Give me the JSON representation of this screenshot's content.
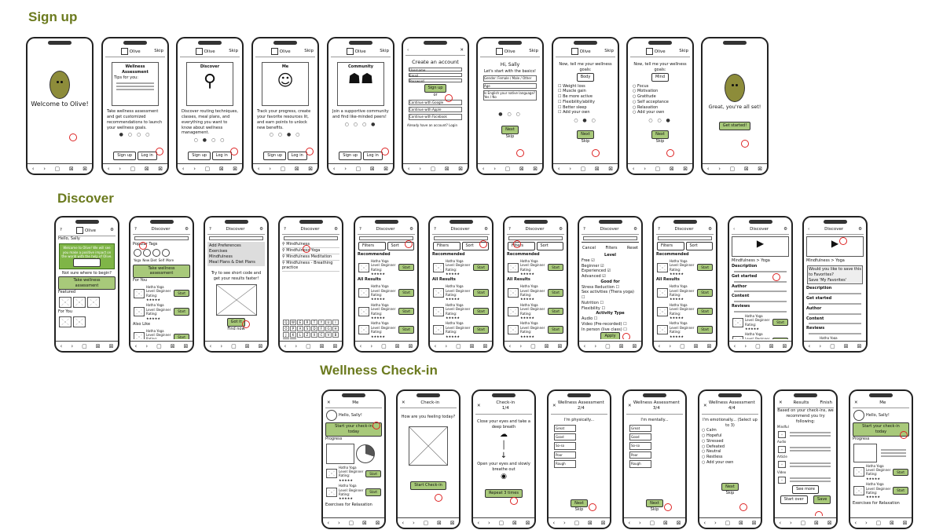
{
  "sections": {
    "signup": "Sign up",
    "discover": "Discover",
    "wellness": "Wellness Check-in"
  },
  "common": {
    "app_name": "Olive",
    "skip": "Skip",
    "sign_up": "Sign up",
    "log_in": "Log in",
    "next": "Next",
    "discover": "Discover",
    "me": "Me",
    "check_in": "Check-in",
    "filters": "Filters",
    "sort": "Sort",
    "recommended": "Recommended",
    "all_results": "All Results",
    "browse_more": "Browse more",
    "not_sure": "Not sure where to begin?",
    "take_assessment": "Take wellness assessment",
    "start": "Start",
    "yoga_title": "Hatha Yoga",
    "level_beginner": "Level: Beginner",
    "level_advanced": "Level: Advanced",
    "rating": "Rating: ★★★★★",
    "nav": [
      "Home",
      "Discover",
      "Me",
      "Community",
      "More"
    ],
    "nav_glyphs": [
      "‹",
      "›",
      "▢",
      "⊠",
      "⊠"
    ]
  },
  "signup": {
    "welcome": "Welcome to Olive!",
    "s2_title": "Wellness Assessment",
    "s2_sub": "Tips for you:",
    "s2_body": "Take wellness assessment and get customized recommendations to launch your wellness goals.",
    "s3_title": "Discover",
    "s3_body": "Discover routing techniques, classes, meal plans, and everything you want to know about wellness management.",
    "s4_title": "Me",
    "s4_body": "Track your progress, create your favorite resources lit, and earn points to unlock new benefits.",
    "s5_title": "Community",
    "s5_body": "Join a supportive community and find like-minded peers!",
    "create_title": "Create an account",
    "ph_username": "Username",
    "ph_email": "Email",
    "ph_password": "Password",
    "or": "or",
    "google": "Continue with Google",
    "apple": "Continue with Apple",
    "facebook": "Continue with Facebook",
    "have_account": "Already have an account?",
    "login_link": "Login",
    "hi": "Hi, Sally",
    "basics": "Let's start with the basics!",
    "gender": "Gender: Female / Male / Other",
    "age": "Age",
    "english": "Is English your native language?",
    "yes_no": "Yes / No",
    "goals": "Now, tell me your wellness goals:",
    "body": "Body",
    "goals_body": [
      "Weight loss",
      "Muscle gain",
      "Be more active",
      "Flexibility/ability",
      "Better sleep",
      "Add your own"
    ],
    "mind": "Mind",
    "goals_mind": [
      "Focus",
      "Motivation",
      "Gratitude",
      "Self acceptance",
      "Relaxation",
      "Add your own"
    ],
    "all_set": "Great, you're all set!",
    "get_started": "Get started!"
  },
  "discover": {
    "hello": "Hello, Sally",
    "banner": "Welcome to Olive! We will see you make a positive impact on the world with the help of Olive.",
    "lets_start": "Let's start",
    "popular": "Popular Tags",
    "yoga": "Yoga",
    "new_diet": "New Diet",
    "self": "Self",
    "more": "More",
    "featured": "Featured",
    "for_you": "For You",
    "also_like": "Also Like",
    "explore": "Explore",
    "try_add": "Try to see short code and get your results faster!",
    "got_it": "Got it",
    "find_now": "Find now",
    "suggestions": [
      "Add Preferences",
      "Exercises",
      "Mindfulness",
      "Meal Plans & Diet Plans"
    ],
    "search_list": [
      "Mindfulness",
      "Mindfulness Yoga",
      "Mindfulness Meditation",
      "Mindfulness - Breathing practice"
    ],
    "sort_by": "Sort Results by",
    "sort_opts": [
      "Recommended",
      "Rating",
      "Most Reviewed"
    ],
    "cancel": "Cancel",
    "reset": "Reset",
    "level": "Level",
    "levels": [
      "Free",
      "Beginner",
      "Experienced",
      "Advanced"
    ],
    "good_for": "Good for",
    "good_for_opts": [
      "Stress Reduction",
      "Sex activities (Thera yoga)",
      "Nutrition",
      "Flexibility"
    ],
    "activity_type": "Activity Type",
    "activity_opts": [
      "Audio",
      "Video (Pre-recorded)",
      "In person (live class)"
    ],
    "apply": "Apply",
    "mindfulness_yoga": "Mindfulness > Yoga",
    "details_rows": [
      "Description",
      "Get started",
      "Author",
      "Content",
      "Reviews"
    ],
    "save_prompt": "Would you like to save this to Favorites?",
    "saved_msg": "Save 'My Favorites'"
  },
  "wellness": {
    "hello": "Hello, Sally!",
    "start_check": "Start your check-in today",
    "progress": "Progress",
    "feeling": "How are you feeling today?",
    "start_checkin": "Start Check-in",
    "step": "1/4",
    "breath": "Close your eyes and take a deep breath",
    "open": "Open your eyes and slowly breathe out",
    "repeat": "Repeat 3 times",
    "assess_title": "Wellness Assessment",
    "a1_step": "2/4",
    "a1_q": "I'm physically...",
    "a1_opts": [
      "Great",
      "Good",
      "So-so",
      "Poor",
      "Rough"
    ],
    "a2_step": "3/4",
    "a2_q": "I'm mentally...",
    "a2_opts": [
      "Great",
      "Good",
      "So-so",
      "Poor",
      "Rough"
    ],
    "a3_step": "4/4",
    "a3_q": "I'm emotionally... (Select up to 3)",
    "a3_opts": [
      "Calm",
      "Hopeful",
      "Stressed",
      "Defeated",
      "Neutral",
      "Restless",
      "Add your own"
    ],
    "results": "Results",
    "finish": "Finish",
    "based_on": "Based on your check-ins, we recommend you try following:",
    "cats": [
      "Mindful",
      "Audio",
      "Article",
      "Video"
    ],
    "see_more": "See more",
    "start_over": "Start over",
    "save": "Save",
    "relax": "Exercises for Relaxation"
  }
}
